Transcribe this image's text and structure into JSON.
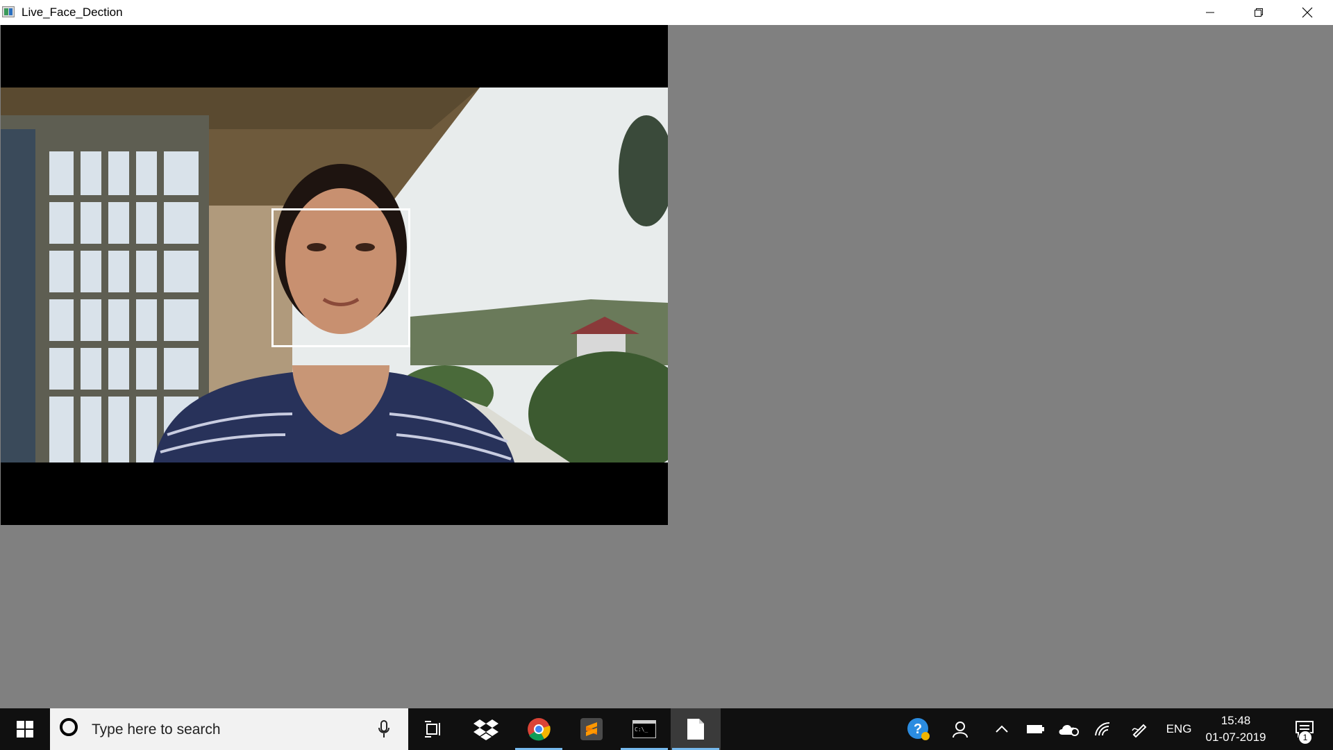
{
  "window": {
    "title": "Live_Face_Dection"
  },
  "video": {
    "description_icon": "webcam-frame",
    "detection_label": ""
  },
  "taskbar": {
    "search_placeholder": "Type here to search",
    "pinned": [
      {
        "name": "task-view-icon"
      },
      {
        "name": "dropbox-icon"
      },
      {
        "name": "chrome-icon"
      },
      {
        "name": "sublime-text-icon"
      },
      {
        "name": "command-prompt-icon"
      },
      {
        "name": "notepad-icon"
      }
    ],
    "tray": {
      "language": "ENG",
      "time": "15:48",
      "date": "01-07-2019",
      "notification_count": "1"
    }
  },
  "colors": {
    "titlebar": "#ffffff",
    "client_bg": "#808080",
    "taskbar": "#101010",
    "active_indicator": "#76b9ed"
  }
}
